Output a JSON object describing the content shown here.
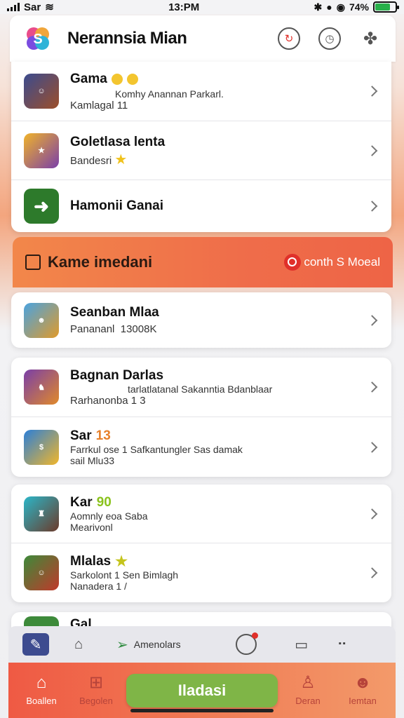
{
  "status_bar": {
    "carrier": "Sar",
    "time": "13:PM",
    "battery_pct": "74%",
    "battery_level": 0.74
  },
  "header": {
    "title": "Nerannsia Mian",
    "icons": [
      "refresh-icon",
      "clock-icon",
      "puzzle-icon"
    ]
  },
  "section1": {
    "rows": [
      {
        "title": "Gama",
        "sub": "Kamlagal 11",
        "desc": "Komhy Anannan Parkarl."
      },
      {
        "title": "Goletlasa lenta",
        "sub": "Bandesri"
      },
      {
        "title": "Hamonii Ganai"
      }
    ]
  },
  "banner": {
    "title": "Kame imedani",
    "action": "conth S Moeal"
  },
  "section2": {
    "rows": [
      {
        "title": "Seanban Mlaa",
        "sub": "Panananl",
        "value": "13008K"
      }
    ]
  },
  "section3": {
    "rows": [
      {
        "title": "Bagnan Darlas",
        "desc": "tarlatlatanal Sakanntia Bdanblaar",
        "sub": "Rarhanonba 1 3"
      },
      {
        "title": "Sar",
        "num": "13",
        "desc": "Farrkul ose 1 Safkantungler Sas damak",
        "sub": "sail Mlu33"
      }
    ]
  },
  "section4": {
    "rows": [
      {
        "title": "Kar",
        "num": "90",
        "desc": "Aomnly eoa Saba",
        "sub": "Mearivonl"
      },
      {
        "title": "Mlalas",
        "desc": "Sarkolont 1 Sen Bimlagh",
        "sub": "Nanadera 1 /"
      }
    ]
  },
  "peek_title": "Gal",
  "toolbar": {
    "label": "Amenolars"
  },
  "bottom_nav": {
    "left1": "Boallen",
    "left2": "Begolen",
    "cta": "Iladasi",
    "right1": "Deran",
    "right2": "Iemtan"
  }
}
